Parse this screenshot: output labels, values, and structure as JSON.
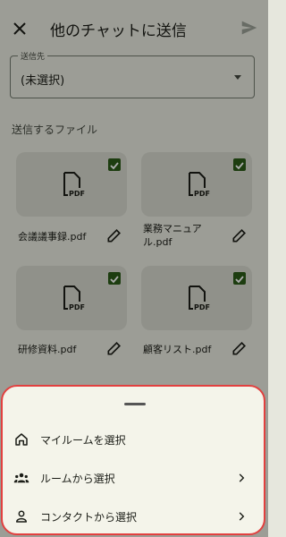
{
  "appbar": {
    "title": "他のチャットに送信"
  },
  "destination": {
    "label": "送信先",
    "value": "(未選択)"
  },
  "files_section": {
    "title": "送信するファイル"
  },
  "files": [
    {
      "name": "会議議事録.pdf",
      "checked": true
    },
    {
      "name": "業務マニュアル.pdf",
      "checked": true
    },
    {
      "name": "研修資料.pdf",
      "checked": true
    },
    {
      "name": "顧客リスト.pdf",
      "checked": true
    }
  ],
  "bottom_sheet": {
    "items": [
      {
        "label": "マイルームを選択",
        "icon": "home-icon",
        "has_chevron": false
      },
      {
        "label": "ルームから選択",
        "icon": "group-icon",
        "has_chevron": true
      },
      {
        "label": "コンタクトから選択",
        "icon": "person-icon",
        "has_chevron": true
      }
    ]
  },
  "colors": {
    "check": "#2b5a19",
    "sheet_border": "#e2403f",
    "background": "#e6e7dd"
  }
}
